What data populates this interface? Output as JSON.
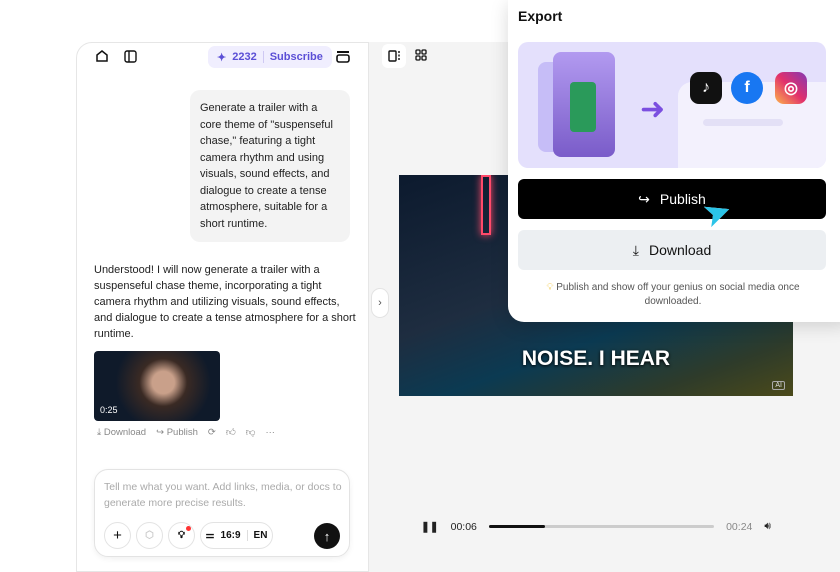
{
  "chat": {
    "credits": "2232",
    "subscribe": "Subscribe",
    "user_message": "Generate a trailer with a core theme of \"suspenseful chase,\" featuring a tight camera rhythm and using visuals, sound effects, and dialogue to create a tense atmosphere, suitable for a short runtime.",
    "assistant_message": "Understood! I will now generate a trailer with a suspenseful chase theme, incorporating a tight camera rhythm and utilizing visuals, sound effects, and dialogue to create a tense atmosphere for a short runtime.",
    "thumb_duration": "0:25",
    "actions": {
      "download": "Download",
      "publish": "Publish"
    },
    "input_placeholder": "Tell me what you want. Add links, media, or docs to generate more precise results.",
    "aspect": "16:9",
    "lang": "EN"
  },
  "player": {
    "caption": "NOISE. I HEAR",
    "ai_badge": "AI",
    "current": "00:06",
    "total": "00:24",
    "progress": 0.25
  },
  "export": {
    "title": "Export",
    "publish": "Publish",
    "download": "Download",
    "note": "Publish and show off your genius on social media once downloaded."
  }
}
